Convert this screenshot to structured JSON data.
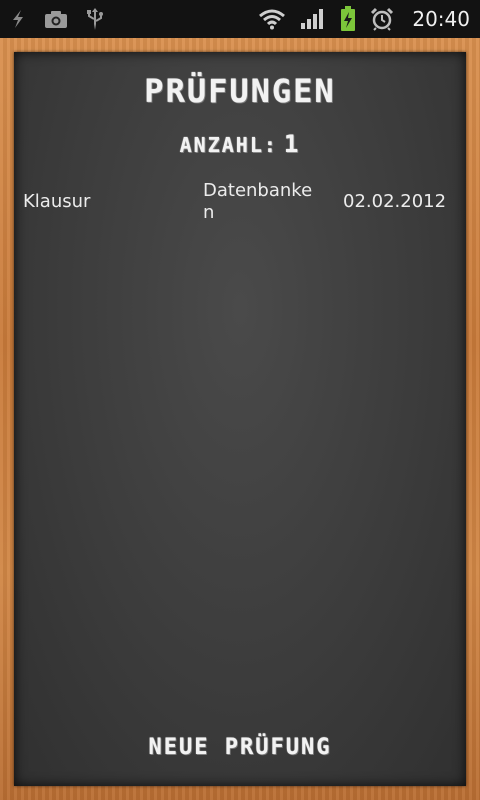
{
  "status_bar": {
    "time": "20:40",
    "icons_left": [
      "flash-icon",
      "camera-icon",
      "usb-icon"
    ],
    "icons_right": [
      "wifi-icon",
      "signal-icon",
      "battery-charging-icon",
      "alarm-icon"
    ]
  },
  "screen": {
    "title": "Prüfungen",
    "count_label": "Anzahl:",
    "count_value": "1",
    "exams": [
      {
        "type": "Klausur",
        "subject": "Datenbanken",
        "date": "02.02.2012"
      }
    ],
    "new_button_label": "Neue Prüfung"
  },
  "colors": {
    "chalkboard": "#3c3c3c",
    "frame_wood": "#c87a3a",
    "chalk_text": "#f2f2f2",
    "battery_green": "#7cc63a"
  }
}
